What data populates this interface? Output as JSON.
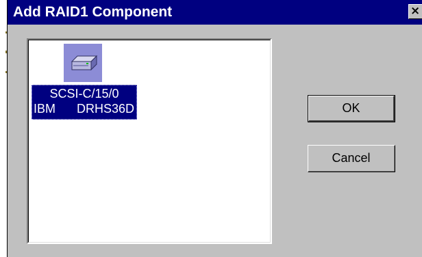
{
  "dialog": {
    "title": "Add RAID1 Component",
    "close_label": "×"
  },
  "component_list": {
    "items": [
      {
        "icon": "disk-drive-icon",
        "location": "SCSI-C/15/0",
        "vendor": "IBM",
        "model": "DRHS36D",
        "selected": true
      }
    ]
  },
  "buttons": {
    "ok_label": "OK",
    "cancel_label": "Cancel"
  },
  "colors": {
    "titlebar": "#000080",
    "dialog_face": "#c0c0c0",
    "selection": "#000080",
    "icon_tile": "#8c8cd6"
  }
}
